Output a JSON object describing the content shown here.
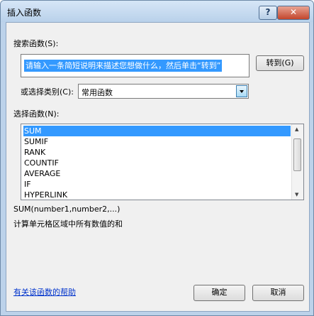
{
  "window": {
    "title": "插入函数",
    "help_glyph": "?",
    "close_glyph": "✕"
  },
  "search": {
    "label": "搜索函数(S):",
    "value": "请输入一条简短说明来描述您想做什么，然后单击“转到”",
    "go_label": "转到(G)"
  },
  "category": {
    "label": "或选择类别(C):",
    "value": "常用函数"
  },
  "functions": {
    "label": "选择函数(N):",
    "items": [
      "SUM",
      "SUMIF",
      "RANK",
      "COUNTIF",
      "AVERAGE",
      "IF",
      "HYPERLINK"
    ],
    "selected_index": 0
  },
  "details": {
    "syntax": "SUM(number1,number2,...)",
    "description": "计算单元格区域中所有数值的和"
  },
  "footer": {
    "help_link": "有关该函数的帮助",
    "ok_label": "确定",
    "cancel_label": "取消"
  }
}
